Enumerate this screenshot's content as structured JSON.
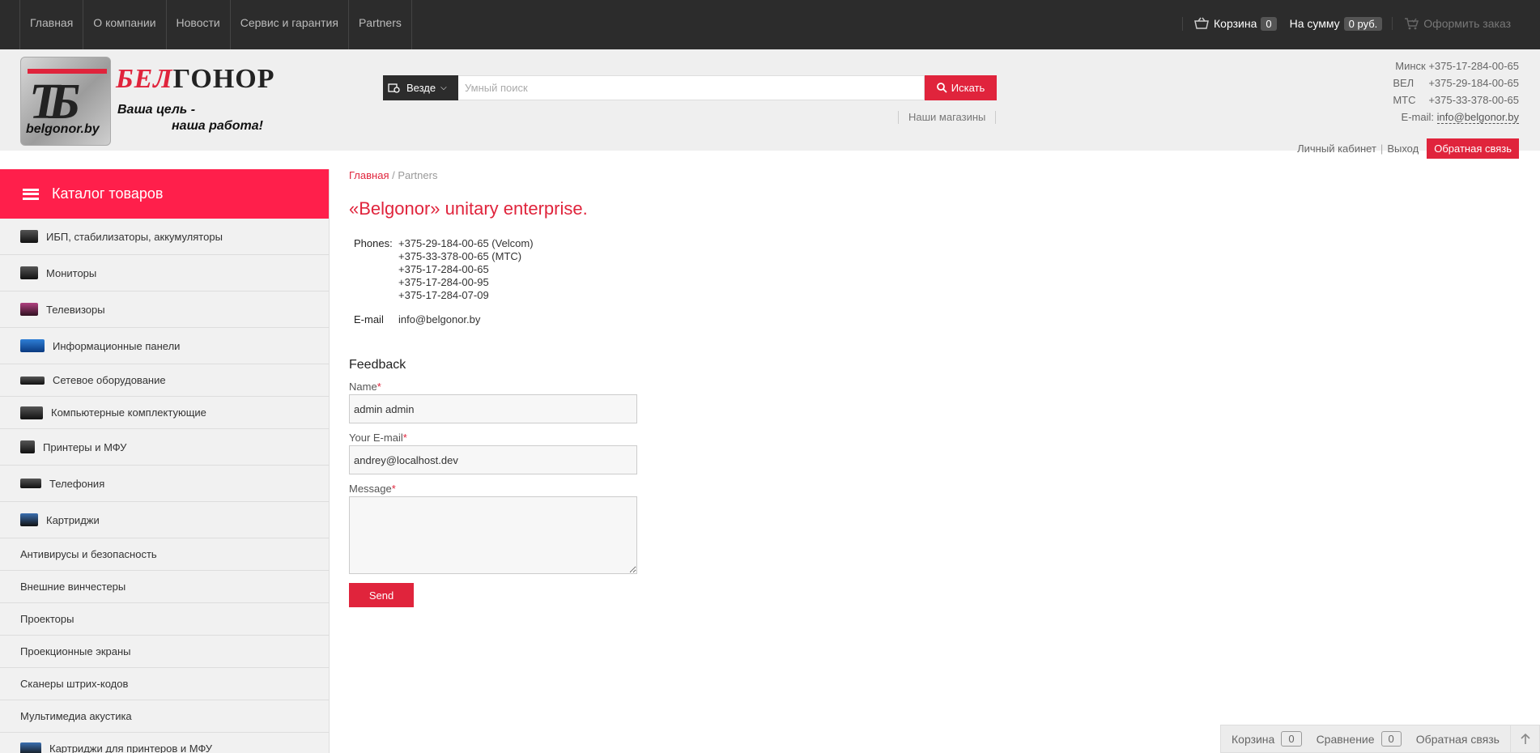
{
  "topnav": [
    {
      "label": "Главная"
    },
    {
      "label": "О компании"
    },
    {
      "label": "Новости"
    },
    {
      "label": "Сервис и гарантия"
    },
    {
      "label": "Partners"
    }
  ],
  "cart": {
    "cart_label": "Корзина",
    "cart_count": "0",
    "sum_label": "На сумму",
    "sum_value": "0 руб.",
    "checkout_label": "Оформить заказ"
  },
  "logo": {
    "brand_red": "БЕЛ",
    "brand_dark": "ГОНОР",
    "slogan1": "Ваша цель -",
    "slogan2": "наша работа!",
    "url": "belgonor.by"
  },
  "search": {
    "scope": "Везде",
    "placeholder": "Умный поиск",
    "button": "Искать",
    "stores": "Наши магазины"
  },
  "contacts": {
    "minsk_label": "Минск",
    "minsk": "+375-17-284-00-65",
    "vel_label": "ВЕЛ",
    "vel": "+375-29-184-00-65",
    "mts_label": "МТС",
    "mts": "+375-33-378-00-65",
    "email_label": "E-mail:",
    "email": "info@belgonor.by"
  },
  "account": {
    "cabinet": "Личный кабинет",
    "sep": "|",
    "logout": "Выход",
    "feedback": "Обратная связь"
  },
  "catalog": {
    "title": "Каталог товаров",
    "items": [
      {
        "label": "ИБП, стабилизаторы, аккумуляторы"
      },
      {
        "label": "Мониторы"
      },
      {
        "label": "Телевизоры"
      },
      {
        "label": "Информационные панели"
      },
      {
        "label": "Сетевое оборудование"
      },
      {
        "label": "Компьютерные комплектующие"
      },
      {
        "label": "Принтеры и МФУ"
      },
      {
        "label": "Телефония"
      },
      {
        "label": "Картриджи"
      },
      {
        "label": "Антивирусы и безопасность"
      },
      {
        "label": "Внешние винчестеры"
      },
      {
        "label": "Проекторы"
      },
      {
        "label": "Проекционные экраны"
      },
      {
        "label": "Сканеры штрих-кодов"
      },
      {
        "label": "Мультимедиа акустика"
      },
      {
        "label": "Картриджи для принтеров и МФУ"
      }
    ]
  },
  "page": {
    "crumb_home": "Главная",
    "crumb_sep": " / ",
    "crumb_current": "Partners",
    "title": "«Belgonor» unitary enterprise.",
    "phones_label": "Phones:",
    "phones": [
      "+375-29-184-00-65 (Velcom)",
      "+375-33-378-00-65 (MTC)",
      "+375-17-284-00-65",
      "+375-17-284-00-95",
      "+375-17-284-07-09"
    ],
    "email_label": "E-mail",
    "email": "info@belgonor.by"
  },
  "form": {
    "title": "Feedback",
    "name_label": "Name",
    "name_value": "admin admin",
    "email_label": "Your E-mail",
    "email_value": "andrey@localhost.dev",
    "message_label": "Message",
    "req": "*",
    "send": "Send"
  },
  "bottombar": {
    "cart_label": "Корзина",
    "cart_count": "0",
    "compare_label": "Сравнение",
    "compare_count": "0",
    "feedback_label": "Обратная связь"
  },
  "colors": {
    "accent": "#e0243c",
    "catalog_header": "#ff1f4b",
    "topbar": "#2c2c2c"
  }
}
